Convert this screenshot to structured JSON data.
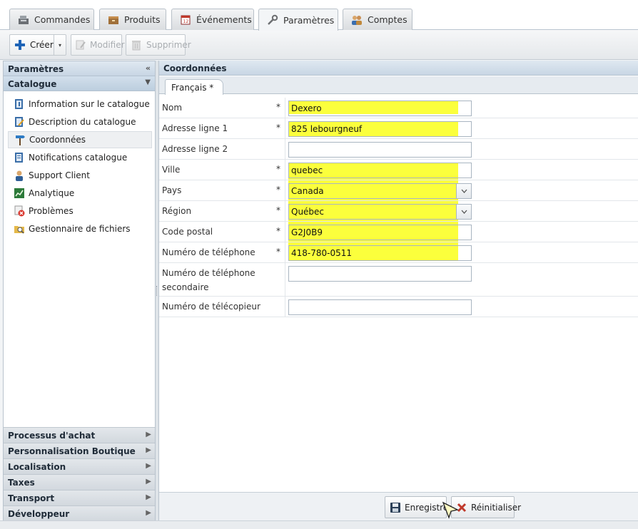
{
  "tabs": [
    {
      "label": "Commandes",
      "icon": "register-icon"
    },
    {
      "label": "Produits",
      "icon": "box-icon"
    },
    {
      "label": "Événements",
      "icon": "calendar-icon"
    },
    {
      "label": "Paramètres",
      "icon": "wrench-icon",
      "active": true
    },
    {
      "label": "Comptes",
      "icon": "users-icon"
    }
  ],
  "toolbar": {
    "create_label": "Créer",
    "modify_label": "Modifier",
    "delete_label": "Supprimer"
  },
  "sidebar": {
    "title": "Paramètres",
    "section": "Catalogue",
    "items": [
      {
        "label": "Information sur le catalogue",
        "icon": "info-book-icon"
      },
      {
        "label": "Description du catalogue",
        "icon": "edit-book-icon"
      },
      {
        "label": "Coordonnées",
        "icon": "signpost-icon",
        "selected": true
      },
      {
        "label": "Notifications catalogue",
        "icon": "notification-icon"
      },
      {
        "label": "Support Client",
        "icon": "support-user-icon"
      },
      {
        "label": "Analytique",
        "icon": "chart-icon"
      },
      {
        "label": "Problèmes",
        "icon": "warning-icon"
      },
      {
        "label": "Gestionnaire de fichiers",
        "icon": "folder-search-icon"
      }
    ],
    "accordion": [
      {
        "label": "Processus d'achat"
      },
      {
        "label": "Personnalisation Boutique"
      },
      {
        "label": "Localisation"
      },
      {
        "label": "Taxes"
      },
      {
        "label": "Transport"
      },
      {
        "label": "Développeur"
      }
    ]
  },
  "main": {
    "title": "Coordonnées",
    "language_tab": "Français *",
    "fields": [
      {
        "label": "Nom",
        "required": "*",
        "value": "Dexero"
      },
      {
        "label": "Adresse ligne 1",
        "required": "*",
        "value": "825 lebourgneuf"
      },
      {
        "label": "Adresse ligne 2",
        "required": "",
        "value": ""
      },
      {
        "label": "Ville",
        "required": "*",
        "value": "quebec"
      },
      {
        "label": "Pays",
        "required": "*",
        "value": "Canada"
      },
      {
        "label": "Région",
        "required": "*",
        "value": "Québec"
      },
      {
        "label": "Code postal",
        "required": "*",
        "value": "G2J0B9"
      },
      {
        "label": "Numéro de téléphone",
        "required": "*",
        "value": "418-780-0511"
      },
      {
        "label": "Numéro de téléphone secondaire",
        "required": "",
        "value": ""
      },
      {
        "label": "Numéro de télécopieur",
        "required": "",
        "value": ""
      }
    ],
    "save_label": "Enregistrer",
    "reset_label": "Réinitialiser"
  },
  "colors": {
    "highlight": "#fbff3c",
    "header_blue": "#c8d6e4",
    "create_plus": "#1e63b6"
  }
}
